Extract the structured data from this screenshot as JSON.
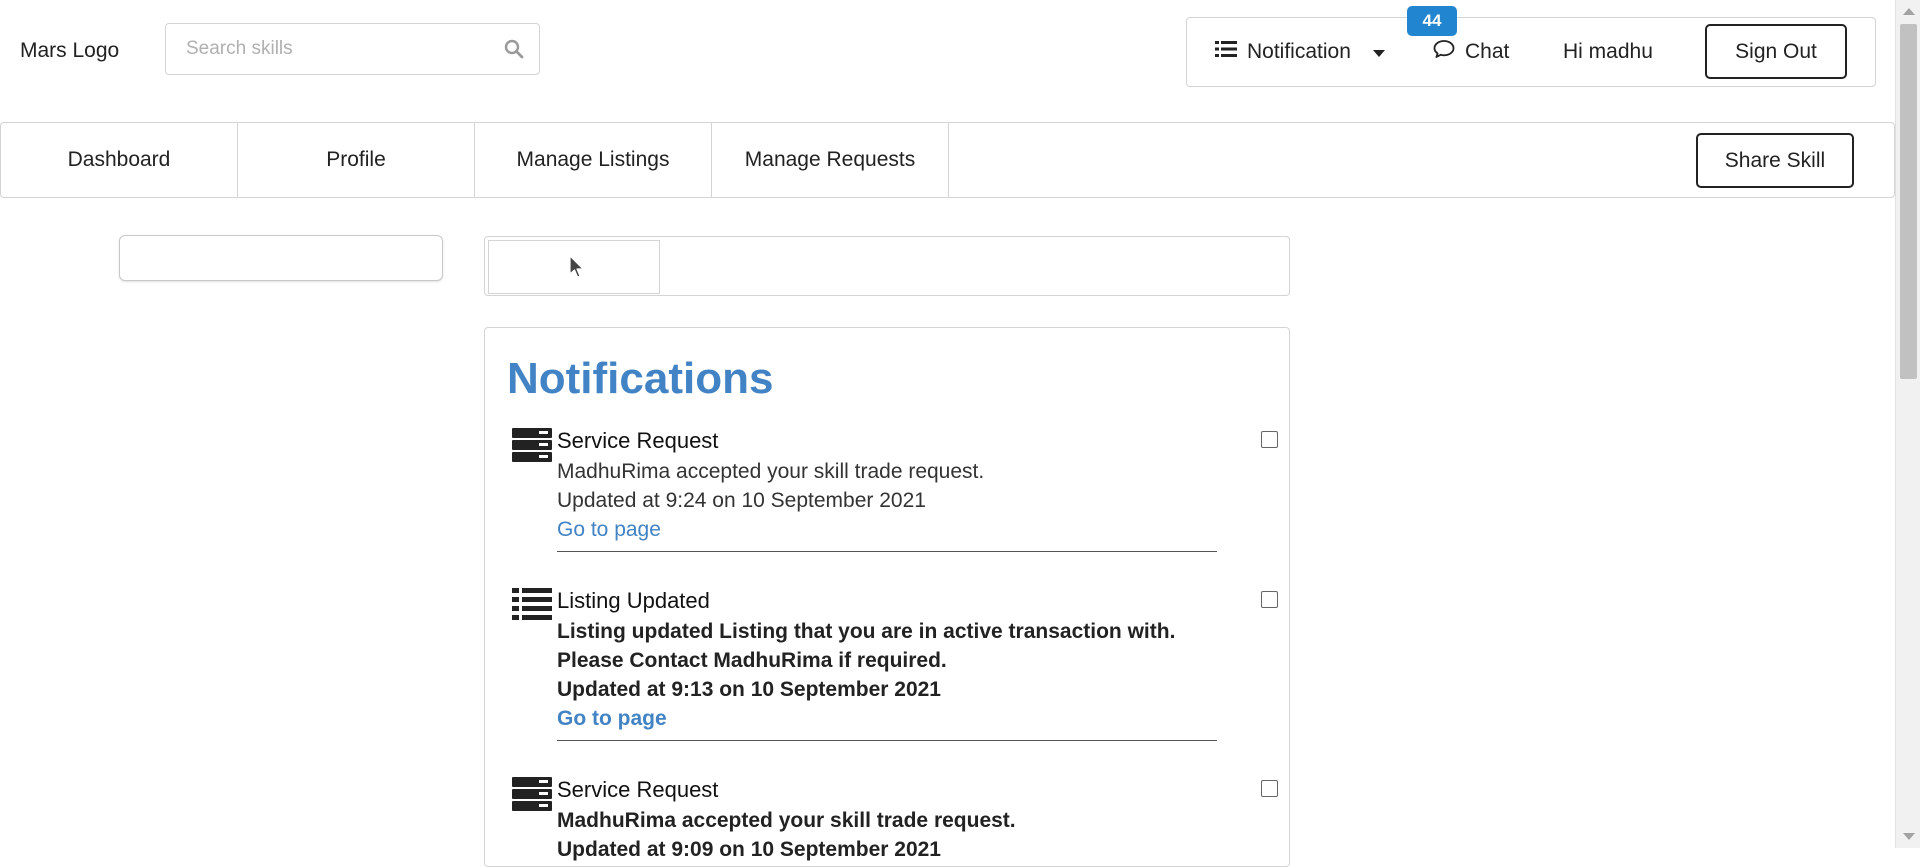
{
  "header": {
    "logo": "Mars Logo",
    "search_placeholder": "Search skills",
    "notification_label": "Notification",
    "notification_count": "44",
    "chat_label": "Chat",
    "greeting": "Hi madhu",
    "signout_label": "Sign Out"
  },
  "nav": {
    "tabs": [
      "Dashboard",
      "Profile",
      "Manage Listings",
      "Manage Requests"
    ],
    "share_label": "Share Skill"
  },
  "notifications": {
    "title": "Notifications",
    "link_label": "Go to page",
    "items": [
      {
        "icon": "server-icon",
        "title": "Service Request",
        "message": "MadhuRima accepted your skill trade request.",
        "updated": "Updated at 9:24 on 10 September 2021",
        "unread": false
      },
      {
        "icon": "list-icon",
        "title": "Listing Updated",
        "message": "Listing updated Listing that you are in active transaction with. Please Contact MadhuRima if required.",
        "updated": "Updated at 9:13 on 10 September 2021",
        "unread": true
      },
      {
        "icon": "server-icon",
        "title": "Service Request",
        "message": "MadhuRima accepted your skill trade request.",
        "updated": "Updated at 9:09 on 10 September 2021",
        "unread": true
      }
    ]
  },
  "colors": {
    "accent": "#4183c4",
    "badge": "#2185d0",
    "text": "#222222",
    "border": "#d4d4d5"
  }
}
